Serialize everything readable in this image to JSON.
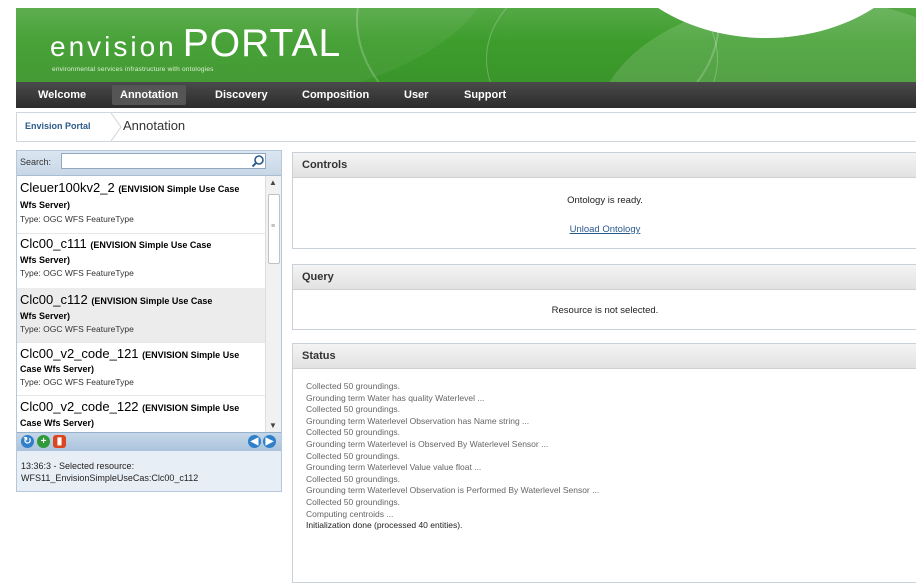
{
  "brand": {
    "envision": "envision",
    "portal": "PORTAL",
    "tagline": "environmental services infrastructure with ontologies"
  },
  "nav": {
    "items": [
      {
        "label": "Welcome"
      },
      {
        "label": "Annotation"
      },
      {
        "label": "Discovery"
      },
      {
        "label": "Composition"
      },
      {
        "label": "User"
      },
      {
        "label": "Support"
      }
    ],
    "active": "Annotation"
  },
  "breadcrumb": {
    "root": "Envision Portal",
    "current": "Annotation"
  },
  "search": {
    "label": "Search:",
    "value": ""
  },
  "resources": [
    {
      "name": "Cleuer100kv2_2",
      "source_a": "(ENVISION Simple Use Case",
      "source_b": "Wfs Server)",
      "type": "Type: OGC WFS FeatureType"
    },
    {
      "name": "Clc00_c111",
      "source_a": "(ENVISION Simple Use Case",
      "source_b": "Wfs Server)",
      "type": "Type: OGC WFS FeatureType"
    },
    {
      "name": "Clc00_c112",
      "source_a": "(ENVISION Simple Use Case",
      "source_b": "Wfs Server)",
      "type": "Type: OGC WFS FeatureType"
    },
    {
      "name": "Clc00_v2_code_121",
      "source_a": "(ENVISION Simple Use",
      "source_b": "Case Wfs Server)",
      "type": "Type: OGC WFS FeatureType"
    },
    {
      "name": "Clc00_v2_code_122",
      "source_a": "(ENVISION Simple Use",
      "source_b": "Case Wfs Server)",
      "type": ""
    }
  ],
  "log": {
    "line1": "13:36:3 - Selected resource:",
    "line2": "WFS11_EnvisionSimpleUseCas:Clc00_c112"
  },
  "controls": {
    "title": "Controls",
    "status": "Ontology is ready.",
    "unload_link": "Unload Ontology"
  },
  "query": {
    "title": "Query",
    "message": "Resource is not selected."
  },
  "status": {
    "title": "Status",
    "lines": [
      "Collected 50 groundings.",
      "Grounding term Water has quality Waterlevel ...",
      "Collected 50 groundings.",
      "Grounding term Waterlevel Observation has Name string ...",
      "Collected 50 groundings.",
      "Grounding term Waterlevel is Observed By Waterlevel Sensor ...",
      "Collected 50 groundings.",
      "Grounding term Waterlevel Value value float ...",
      "Collected 50 groundings.",
      "Grounding term Waterlevel Observation is Performed By Waterlevel Sensor ...",
      "Collected 50 groundings.",
      "Computing centroids ...",
      "Initialization done (processed 40 entities)."
    ]
  },
  "icons": {
    "refresh": "refresh-icon",
    "add": "add-icon",
    "delete": "delete-icon",
    "prev": "prev-icon",
    "next": "next-icon",
    "search": "search-icon"
  },
  "colors": {
    "header_green": "#3d9d2c",
    "nav_dark": "#333333",
    "link_blue": "#2a5a8c"
  }
}
